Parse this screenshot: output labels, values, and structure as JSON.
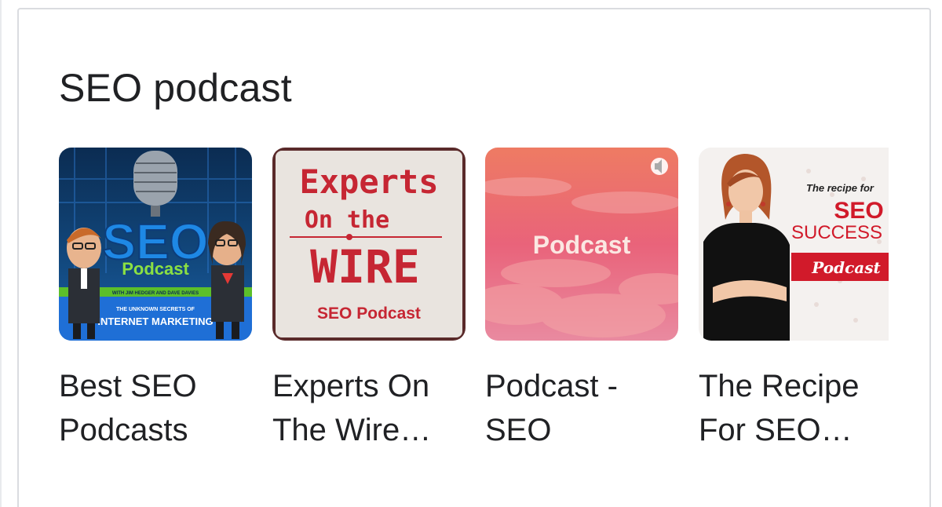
{
  "section": {
    "title": "SEO podcast"
  },
  "podcasts": [
    {
      "caption": "Best SEO\nPodcasts",
      "art": {
        "big_word": "SEO",
        "sub_word": "Podcast",
        "banner_top": "WITH JIM HEDGER AND DAVE DAVIES",
        "banner_small": "THE UNKNOWN SECRETS OF",
        "banner_main": "INTERNET MARKETING"
      }
    },
    {
      "caption": "Experts On\nThe Wire…",
      "art": {
        "line1": "Experts",
        "line2": "On the",
        "line3": "WIRE",
        "line4": "SEO Podcast"
      }
    },
    {
      "caption": "Podcast -\nSEO",
      "art": {
        "word": "Podcast"
      }
    },
    {
      "caption": "The Recipe\nFor SEO…",
      "art": {
        "line1": "The recipe for",
        "line2": "SEO",
        "line3": "SUCCESS",
        "line4": "Podcast"
      }
    }
  ]
}
